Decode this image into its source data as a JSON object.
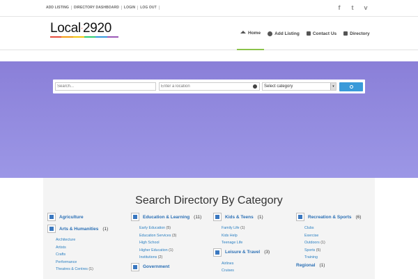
{
  "topbar": {
    "links": [
      "ADD LISTING",
      "DIRECTORY DASHBOARD",
      "LOGIN",
      "LOG OUT"
    ],
    "social": [
      "f",
      "t",
      "v"
    ]
  },
  "logo": {
    "text_left": "Local",
    "text_right": "2920",
    "colors": [
      "#e74c3c",
      "#f39c12",
      "#f1c40f",
      "#2ecc71",
      "#3498db",
      "#9b59b6"
    ]
  },
  "nav": {
    "home": "Home",
    "add_listing": "Add Listing",
    "contact": "Contact Us",
    "directory": "Directory",
    "active_color": "#8bc34a"
  },
  "search": {
    "keyword_placeholder": "Search...",
    "location_placeholder": "Enter a location",
    "category_selected": "Select category"
  },
  "hero": {
    "color_top": "#8a7fd8",
    "color_bottom": "#9c97e6"
  },
  "directory": {
    "title": "Search Directory By Category",
    "columns": [
      {
        "cats": [
          {
            "name": "Agriculture",
            "count": "",
            "subs": []
          },
          {
            "name": "Arts & Humanities",
            "count": "(1)",
            "subs": [
              {
                "name": "Architecture",
                "count": ""
              },
              {
                "name": "Artists",
                "count": ""
              },
              {
                "name": "Crafts",
                "count": ""
              },
              {
                "name": "Performance",
                "count": ""
              },
              {
                "name": "Theatres & Centres",
                "count": "(1)"
              }
            ]
          }
        ]
      },
      {
        "cats": [
          {
            "name": "Education & Learning",
            "count": "(11)",
            "subs": [
              {
                "name": "Early Education",
                "count": "(5)"
              },
              {
                "name": "Education Services",
                "count": "(3)"
              },
              {
                "name": "High School",
                "count": ""
              },
              {
                "name": "Higher Education",
                "count": "(1)"
              },
              {
                "name": "Institutions",
                "count": "(2)"
              }
            ]
          },
          {
            "name": "Government",
            "count": "",
            "subs": []
          }
        ]
      },
      {
        "cats": [
          {
            "name": "Kids & Teens",
            "count": "(1)",
            "subs": [
              {
                "name": "Family Life",
                "count": "(1)"
              },
              {
                "name": "Kids Help",
                "count": ""
              },
              {
                "name": "Teenage Life",
                "count": ""
              }
            ]
          },
          {
            "name": "Leisure & Travel",
            "count": "(3)",
            "subs": [
              {
                "name": "Airlines",
                "count": ""
              },
              {
                "name": "Cruises",
                "count": ""
              }
            ]
          }
        ]
      },
      {
        "cats": [
          {
            "name": "Recreation & Sports",
            "count": "(6)",
            "subs": [
              {
                "name": "Clubs",
                "count": ""
              },
              {
                "name": "Exercise",
                "count": ""
              },
              {
                "name": "Outdoors",
                "count": "(1)"
              },
              {
                "name": "Sports",
                "count": "(5)"
              },
              {
                "name": "Training",
                "count": ""
              }
            ]
          },
          {
            "name": "Regional",
            "count": "(1)",
            "subs": [],
            "noicon": true
          }
        ]
      }
    ]
  }
}
